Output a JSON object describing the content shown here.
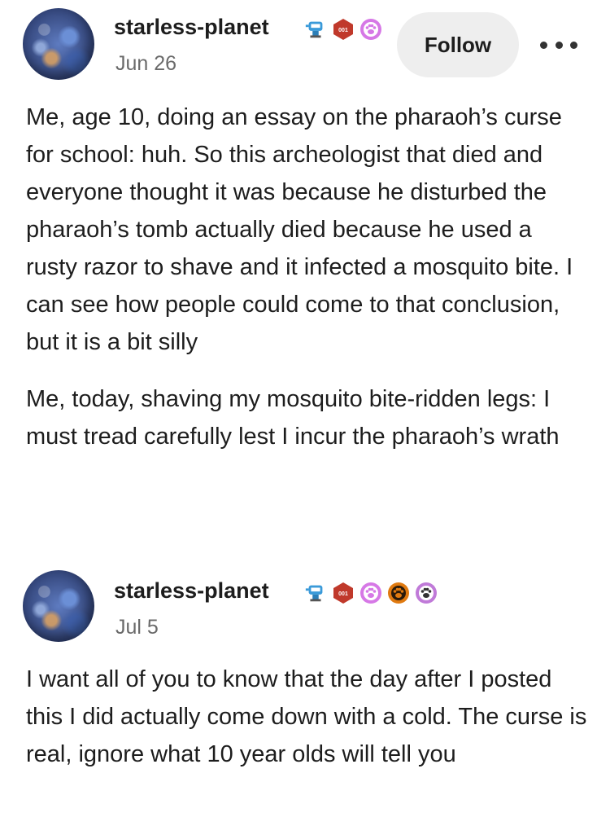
{
  "posts": [
    {
      "username": "starless-planet",
      "date": "Jun 26",
      "follow_label": "Follow",
      "badges": [
        "robot-badge-icon",
        "hexagon-badge-icon",
        "paw-badge-icon"
      ],
      "paragraphs": [
        "Me, age 10, doing an essay on the pharaoh’s curse for school: huh. So this archeologist that died and everyone thought it was because he disturbed the pharaoh’s tomb actually died because he used a rusty razor to shave and it infected a mosquito bite. I can see how people could come to that conclusion, but it is a bit silly",
        "Me, today, shaving my mosquito bite-ridden legs: I must tread carefully lest I incur the pharaoh’s wrath"
      ]
    },
    {
      "username": "starless-planet",
      "date": "Jul 5",
      "badges": [
        "robot-badge-icon",
        "hexagon-badge-icon",
        "paw-badge-icon",
        "paw-badge-icon",
        "paw-badge-icon"
      ],
      "paragraphs": [
        "I want all of you to know that the day after I posted this I did actually come down with a cold. The curse is real, ignore what 10 year olds will tell you"
      ]
    }
  ],
  "colors": {
    "text": "#1d1d1d",
    "muted": "#6a6a6a",
    "follow_bg": "#eeeeee",
    "hex_badge": "#c0392b",
    "paw_pink": "#d678e6",
    "paw_orange": "#e07a10",
    "paw_dark": "#333333"
  }
}
